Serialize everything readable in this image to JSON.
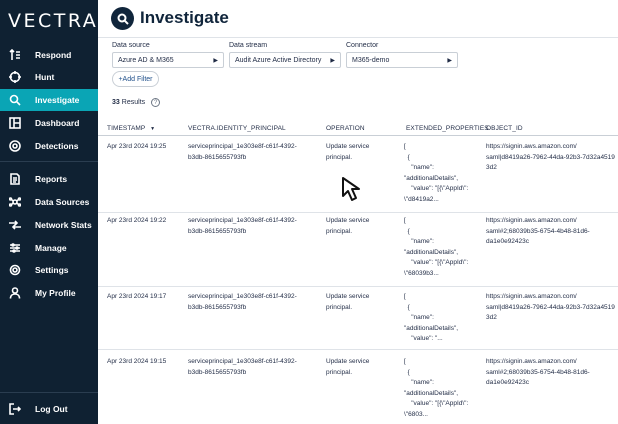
{
  "logo": "VECTRA",
  "nav": {
    "items": [
      {
        "label": "Respond",
        "icon": "respond-icon"
      },
      {
        "label": "Hunt",
        "icon": "crosshair-icon"
      },
      {
        "label": "Investigate",
        "icon": "search-icon",
        "active": true
      },
      {
        "label": "Dashboard",
        "icon": "dashboard-icon"
      },
      {
        "label": "Detections",
        "icon": "detections-icon"
      },
      {
        "label": "Reports",
        "icon": "reports-icon"
      },
      {
        "label": "Data Sources",
        "icon": "data-sources-icon"
      },
      {
        "label": "Network Stats",
        "icon": "network-stats-icon"
      },
      {
        "label": "Manage",
        "icon": "manage-icon"
      },
      {
        "label": "Settings",
        "icon": "gear-icon"
      },
      {
        "label": "My Profile",
        "icon": "user-icon"
      }
    ],
    "logout": "Log Out"
  },
  "header": {
    "title": "Investigate",
    "icon": "search-icon"
  },
  "filters": {
    "data_source": {
      "label": "Data source",
      "value": "Azure AD & M365"
    },
    "data_stream": {
      "label": "Data stream",
      "value": "Audit Azure Active Directory"
    },
    "connector": {
      "label": "Connector",
      "value": "M365-demo"
    },
    "add_filter": "+Add Filter"
  },
  "results": {
    "count": "33",
    "label": "Results",
    "info": "?"
  },
  "table": {
    "columns": [
      "TIMESTAMP",
      "VECTRA.IDENTITY_PRINCIPAL",
      "OPERATION",
      "EXTENDED_PROPERTIES",
      "OBJECT_ID"
    ],
    "sort_indicator": "▼",
    "rows": [
      {
        "timestamp": "Apr 23rd 2024 19:25",
        "principal": "serviceprincipal_1e303e8f-c61f-4392-\nb3db-8615655793fb",
        "operation": "Update service\nprincipal.",
        "extended": "[\n  {\n    \"name\":\n\"additionalDetails\",\n    \"value\": \"[{\\\"AppId\\\":\n\\\"d8419a2...",
        "object_id": "https://signin.aws.amazon.com/\nsaml|d8419a26-7962-44da-92b3-7d32a4519\n3d2"
      },
      {
        "timestamp": "Apr 23rd 2024 19:22",
        "principal": "serviceprincipal_1e303e8f-c61f-4392-\nb3db-8615655793fb",
        "operation": "Update service\nprincipal.",
        "extended": "[\n  {\n    \"name\":\n\"additionalDetails\",\n    \"value\": \"[{\\\"AppId\\\":\n\\\"68039b3...",
        "object_id": "https://signin.aws.amazon.com/\nsaml#2;68039b35-6754-4b48-81d6-\nda1e0e92423c"
      },
      {
        "timestamp": "Apr 23rd 2024 19:17",
        "principal": "serviceprincipal_1e303e8f-c61f-4392-\nb3db-8615655793fb",
        "operation": "Update service\nprincipal.",
        "extended": "[\n  {\n    \"name\":\n\"additionalDetails\",\n    \"value\": \"...",
        "object_id": "https://signin.aws.amazon.com/\nsaml|d8419a26-7962-44da-92b3-7d32a4519\n3d2"
      },
      {
        "timestamp": "Apr 23rd 2024 19:15",
        "principal": "serviceprincipal_1e303e8f-c61f-4392-\nb3db-8615655793fb",
        "operation": "Update service\nprincipal.",
        "extended": "[\n  {\n    \"name\":\n\"additionalDetails\",\n    \"value\": \"[{\\\"AppId\\\":\n\\\"6803...",
        "object_id": "https://signin.aws.amazon.com/\nsaml#2;68039b35-6754-4b48-81d6-\nda1e0e92423c"
      }
    ]
  },
  "colors": {
    "sidebar_bg": "#0f2132",
    "active_item": "#0aa5b5",
    "title": "#10253b"
  }
}
